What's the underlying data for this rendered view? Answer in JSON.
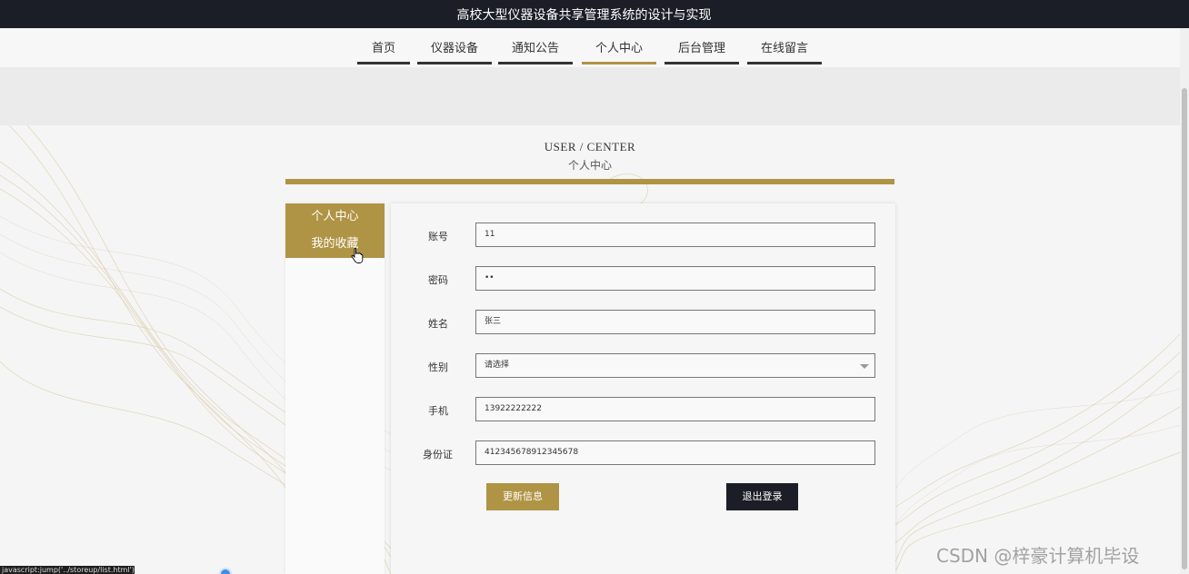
{
  "app": {
    "title": "高校大型仪器设备共享管理系统的设计与实现"
  },
  "nav": {
    "items": [
      {
        "label": "首页",
        "active": false
      },
      {
        "label": "仪器设备",
        "active": false
      },
      {
        "label": "通知公告",
        "active": false
      },
      {
        "label": "个人中心",
        "active": true
      },
      {
        "label": "后台管理",
        "active": false
      },
      {
        "label": "在线留言",
        "active": false
      }
    ]
  },
  "section": {
    "title_en": "USER / CENTER",
    "title_cn": "个人中心"
  },
  "side_menu": {
    "items": [
      {
        "label": "个人中心"
      },
      {
        "label": "我的收藏"
      }
    ]
  },
  "form": {
    "fields": [
      {
        "label": "账号",
        "value": "11"
      },
      {
        "label": "密码",
        "value": "••"
      },
      {
        "label": "姓名",
        "value": "张三"
      },
      {
        "label": "性别",
        "value": "请选择",
        "type": "select"
      },
      {
        "label": "手机",
        "value": "13922222222"
      },
      {
        "label": "身份证",
        "value": "412345678912345678"
      }
    ],
    "update_button": "更新信息",
    "logout_button": "退出登录"
  },
  "status_bar": {
    "url": "javascript:jump('../storeup/list.html')"
  },
  "watermark": "CSDN @梓豪计算机毕设",
  "colors": {
    "accent": "#b09445",
    "dark": "#1b1e27"
  }
}
